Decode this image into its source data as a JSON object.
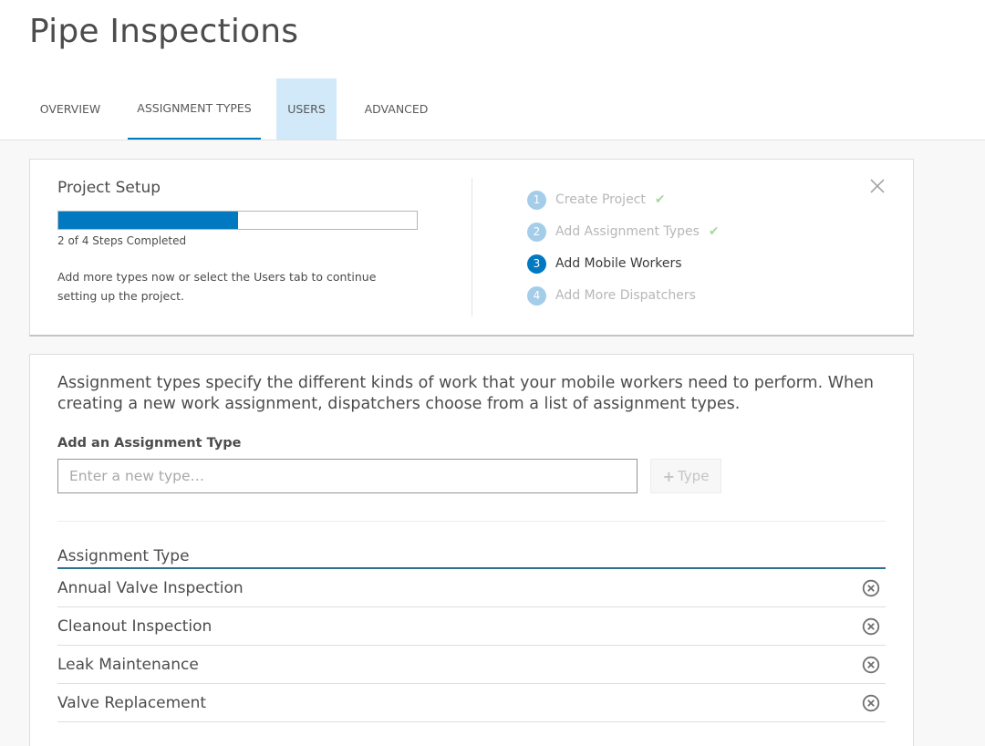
{
  "header": {
    "title": "Pipe Inspections",
    "tabs": [
      {
        "label": "OVERVIEW"
      },
      {
        "label": "ASSIGNMENT TYPES"
      },
      {
        "label": "USERS"
      },
      {
        "label": "ADVANCED"
      }
    ]
  },
  "setup": {
    "title": "Project Setup",
    "progress_fraction": 0.5,
    "progress_text": "2 of 4 Steps Completed",
    "description": "Add more types now or select the Users tab to continue setting up the project.",
    "steps": [
      {
        "number": "1",
        "label": "Create Project",
        "status": "completed"
      },
      {
        "number": "2",
        "label": "Add Assignment Types",
        "status": "completed"
      },
      {
        "number": "3",
        "label": "Add Mobile Workers",
        "status": "current"
      },
      {
        "number": "4",
        "label": "Add More Dispatchers",
        "status": "pending"
      }
    ],
    "check_glyph": "✔",
    "close_icon": "close-icon"
  },
  "assignment": {
    "intro": "Assignment types specify the different kinds of work that your mobile workers need to perform. When creating a new work assignment, dispatchers choose from a list of assignment types.",
    "field_label": "Add an Assignment Type",
    "input_placeholder": "Enter a new type…",
    "input_value": "",
    "add_button_icon": "+",
    "add_button_label": "Type",
    "table_header": "Assignment Type",
    "rows": [
      {
        "label": "Annual Valve Inspection"
      },
      {
        "label": "Cleanout Inspection"
      },
      {
        "label": "Leak Maintenance"
      },
      {
        "label": "Valve Replacement"
      }
    ]
  },
  "colors": {
    "accent": "#0079c1",
    "step_done": "#a4cdea",
    "check": "#a6d9a0",
    "tab_hover": "#d2e9f9"
  }
}
